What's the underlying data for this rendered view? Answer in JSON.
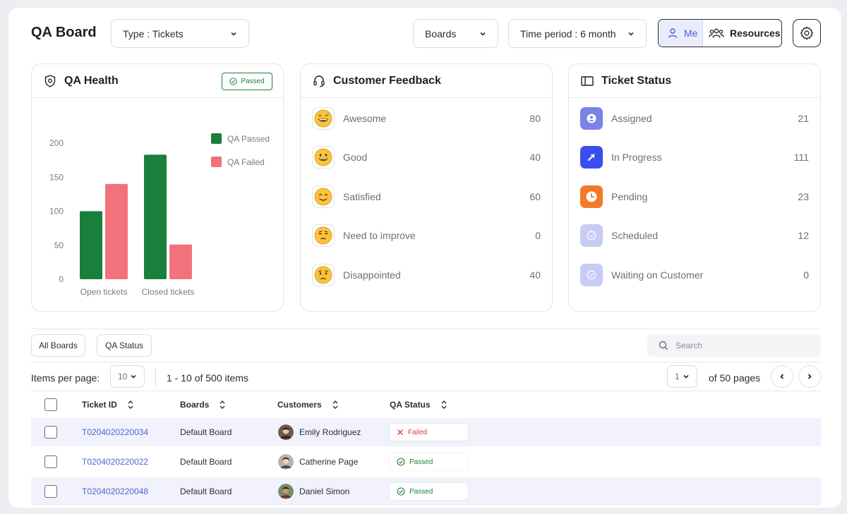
{
  "header": {
    "title": "QA Board",
    "type_select": "Type : Tickets",
    "boards_select": "Boards",
    "time_select": "Time period : 6 month",
    "toggle_me": "Me",
    "toggle_resources": "Resources"
  },
  "qa_health": {
    "title": "QA Health",
    "badge": "Passed",
    "chart_data": {
      "type": "bar",
      "categories": [
        "Open tickets",
        "Closed tickets"
      ],
      "series": [
        {
          "name": "QA Passed",
          "values": [
            100,
            183
          ],
          "color": "#1a7f3c"
        },
        {
          "name": "QA Failed",
          "values": [
            140,
            51
          ],
          "color": "#f2727c"
        }
      ],
      "yticks": [
        0,
        50,
        100,
        150,
        200
      ],
      "ylim": [
        0,
        200
      ],
      "legend": "top-right",
      "grid": false
    }
  },
  "feedback": {
    "title": "Customer Feedback",
    "items": [
      {
        "label": "Awesome",
        "count": "80",
        "icon": "grinning-sweat-face-icon"
      },
      {
        "label": "Good",
        "count": "40",
        "icon": "grinning-face-icon"
      },
      {
        "label": "Satisfied",
        "count": "60",
        "icon": "smiling-face-icon"
      },
      {
        "label": "Need to improve",
        "count": "0",
        "icon": "unamused-face-icon"
      },
      {
        "label": "Disappointed",
        "count": "40",
        "icon": "crying-face-icon"
      }
    ]
  },
  "ticket_status": {
    "title": "Ticket Status",
    "items": [
      {
        "label": "Assigned",
        "count": "21",
        "icon": "user-circle-icon",
        "color": "#7b83e8"
      },
      {
        "label": "In Progress",
        "count": "111",
        "icon": "arrow-up-right-icon",
        "color": "#3a4ef0"
      },
      {
        "label": "Pending",
        "count": "23",
        "icon": "clock-icon",
        "color": "#f27a2a"
      },
      {
        "label": "Scheduled",
        "count": "12",
        "icon": "badge-check-icon",
        "color": "#c8cbf6"
      },
      {
        "label": "Waiting on Customer",
        "count": "0",
        "icon": "badge-check-icon",
        "color": "#c8cbf6"
      }
    ]
  },
  "filters": {
    "all_boards": "All Boards",
    "qa_status": "QA Status",
    "search_placeholder": "Search"
  },
  "pagination": {
    "items_per_page_label": "Items per page:",
    "items_per_page": "10",
    "range": "1 - 10 of 500 items",
    "page": "1",
    "of_pages": "of 50 pages"
  },
  "table": {
    "columns": [
      "Ticket ID",
      "Boards",
      "Customers",
      "QA Status"
    ],
    "rows": [
      {
        "ticket_id": "T0204020220034",
        "board": "Default Board",
        "customer": "Emily Rodriguez",
        "status": "Failed"
      },
      {
        "ticket_id": "T0204020220022",
        "board": "Default Board",
        "customer": "Catherine Page",
        "status": "Passed"
      },
      {
        "ticket_id": "T0204020220048",
        "board": "Default Board",
        "customer": "Daniel Simon",
        "status": "Passed"
      }
    ]
  }
}
